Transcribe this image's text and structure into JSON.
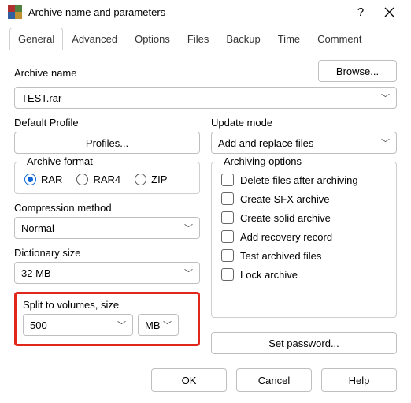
{
  "title": "Archive name and parameters",
  "tabs": [
    "General",
    "Advanced",
    "Options",
    "Files",
    "Backup",
    "Time",
    "Comment"
  ],
  "archive_name_label": "Archive name",
  "browse_label": "Browse...",
  "archive_name_value": "TEST.rar",
  "default_profile_label": "Default Profile",
  "profiles_button": "Profiles...",
  "update_mode_label": "Update mode",
  "update_mode_value": "Add and replace files",
  "archive_format": {
    "title": "Archive format",
    "options": [
      "RAR",
      "RAR4",
      "ZIP"
    ],
    "selected": "RAR"
  },
  "compression_label": "Compression method",
  "compression_value": "Normal",
  "dictionary_label": "Dictionary size",
  "dictionary_value": "32 MB",
  "split_label": "Split to volumes, size",
  "split_value": "500",
  "split_unit": "MB",
  "archiving_options": {
    "title": "Archiving options",
    "items": [
      "Delete files after archiving",
      "Create SFX archive",
      "Create solid archive",
      "Add recovery record",
      "Test archived files",
      "Lock archive"
    ]
  },
  "set_password": "Set password...",
  "footer": {
    "ok": "OK",
    "cancel": "Cancel",
    "help": "Help"
  }
}
